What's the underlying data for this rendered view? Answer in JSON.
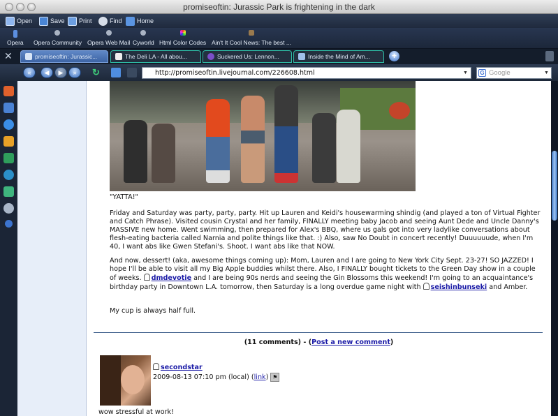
{
  "window": {
    "title": "promiseoftin: Jurassic Park is frightening in the dark"
  },
  "toolbar": {
    "open": "Open",
    "save": "Save",
    "print": "Print",
    "find": "Find",
    "home": "Home"
  },
  "bookmarks": [
    "Opera",
    "Opera Community",
    "Opera Web Mail",
    "Cyworld",
    "Html Color Codes",
    "Ain't It Cool News: The best ..."
  ],
  "tabs": [
    {
      "label": "promiseoftin: Jurassic...",
      "active": true
    },
    {
      "label": "The Deli LA - All abou...",
      "active": false
    },
    {
      "label": "Suckered Us: Lennon...",
      "active": false
    },
    {
      "label": "Inside the Mind of Am...",
      "active": false
    }
  ],
  "address": {
    "url": "http://promiseoftin.livejournal.com/226608.html",
    "search_placeholder": "Google"
  },
  "post": {
    "caption": "\"YATTA!\"",
    "para1": "Friday and Saturday was party, party, party. Hit up Lauren and Keidi's housewarming shindig (and played a ton of Virtual Fighter and Catch Phrase). Visited cousin Crystal and her family, FINALLY meeting baby Jacob and seeing Aunt Dede and Uncle Danny's MASSIVE new home. Went swimming, then prepared for Alex's BBQ, where us gals got into very ladylike conversations about flesh-eating bacteria called Narnia and polite things like that. :) Also, saw No Doubt in concert recently! Duuuuuude, when I'm 40, I want abs like Gwen Stefani's. Shoot. I want abs like that NOW.",
    "para2a": "And now, dessert! (aka, awesome things coming up): Mom, Lauren and I are going to New York City Sept. 23-27! SO JAZZED! I hope I'll be able to visit all my Big Apple buddies whilst there. Also, I FINALLY bought tickets to the Green Day show in a couple of weeks.",
    "user1": "dmdevotie",
    "para2b": "and I are being 90s nerds and seeing the Gin Blossoms this weekend! I'm going to an acquaintance's birthday party in Downtown L.A. tomorrow, then Saturday is a long overdue game night with",
    "user2": "seishinbunseki",
    "para2c": "and Amber.",
    "para3": "My cup is always half full."
  },
  "comments": {
    "count": "(11 comments) - (",
    "post_link": "Post a new comment",
    "close": ")",
    "first": {
      "user": "secondstar",
      "date": "2009-08-13 07:10 pm (local) (",
      "link": "link",
      "date_close": ")",
      "text": "wow stressful at work!"
    }
  },
  "colors": {
    "link": "#1a1aa6",
    "separator": "#375a88",
    "chrome": "#1e2a3c"
  }
}
